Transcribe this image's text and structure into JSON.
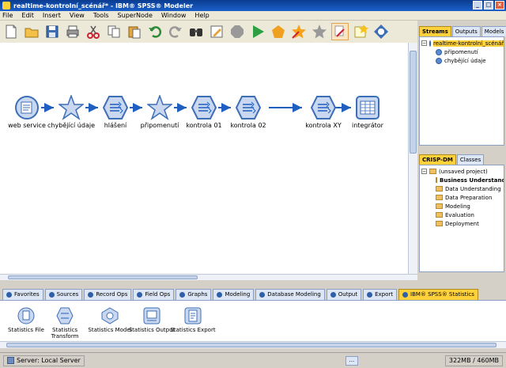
{
  "window": {
    "title": "realtime-kontrolní_scénář* - IBM® SPSS® Modeler"
  },
  "menu": [
    "File",
    "Edit",
    "Insert",
    "View",
    "Tools",
    "SuperNode",
    "Window",
    "Help"
  ],
  "toolbar": [
    "new-stream",
    "open-stream",
    "save-stream",
    "print",
    "cut",
    "copy",
    "paste",
    "undo",
    "redo",
    "find",
    "edit-annotation",
    "stop",
    "run",
    "run-selection",
    "favorites-star",
    "star",
    "create-supernode",
    "new-comment",
    "help"
  ],
  "nodes": [
    {
      "label": "web service",
      "icon": "source-icon"
    },
    {
      "label": "chybějící údaje",
      "icon": "star-icon"
    },
    {
      "label": "hlášení",
      "icon": "process-icon"
    },
    {
      "label": "připomenutí",
      "icon": "star-icon"
    },
    {
      "label": "kontrola 01",
      "icon": "process-icon"
    },
    {
      "label": "kontrola 02",
      "icon": "process-icon"
    },
    {
      "label": "kontrola XY",
      "icon": "process-icon"
    },
    {
      "label": "integrátor",
      "icon": "table-icon"
    }
  ],
  "managers": {
    "tabs": [
      "Streams",
      "Outputs",
      "Models"
    ],
    "selected": "Streams",
    "tree": {
      "root": "realtime-kontrolní_scénář",
      "children": [
        "připomenutí",
        "chybějící údaje"
      ]
    }
  },
  "project": {
    "tabs": [
      "CRISP-DM",
      "Classes"
    ],
    "selected": "CRISP-DM",
    "root": "(unsaved project)",
    "children": [
      "Business Understanding",
      "Data Understanding",
      "Data Preparation",
      "Modeling",
      "Evaluation",
      "Deployment"
    ]
  },
  "palette_tabs": [
    "Favorites",
    "Sources",
    "Record Ops",
    "Field Ops",
    "Graphs",
    "Modeling",
    "Database Modeling",
    "Output",
    "Export",
    "IBM® SPSS® Statistics"
  ],
  "palette_selected": "IBM® SPSS® Statistics",
  "palette_items": [
    "Statistics File",
    "Statistics Transform",
    "Statistics Model",
    "Statistics Output",
    "Statistics Export"
  ],
  "status": {
    "server": "Server: Local Server",
    "middle": "...",
    "memory": "322MB / 460MB"
  },
  "colors": {
    "title_bar": "#1b5fc9",
    "selected_tab": "#ffd23c",
    "node_fill": "#c9d8f0",
    "node_stroke": "#3d6fb6"
  }
}
